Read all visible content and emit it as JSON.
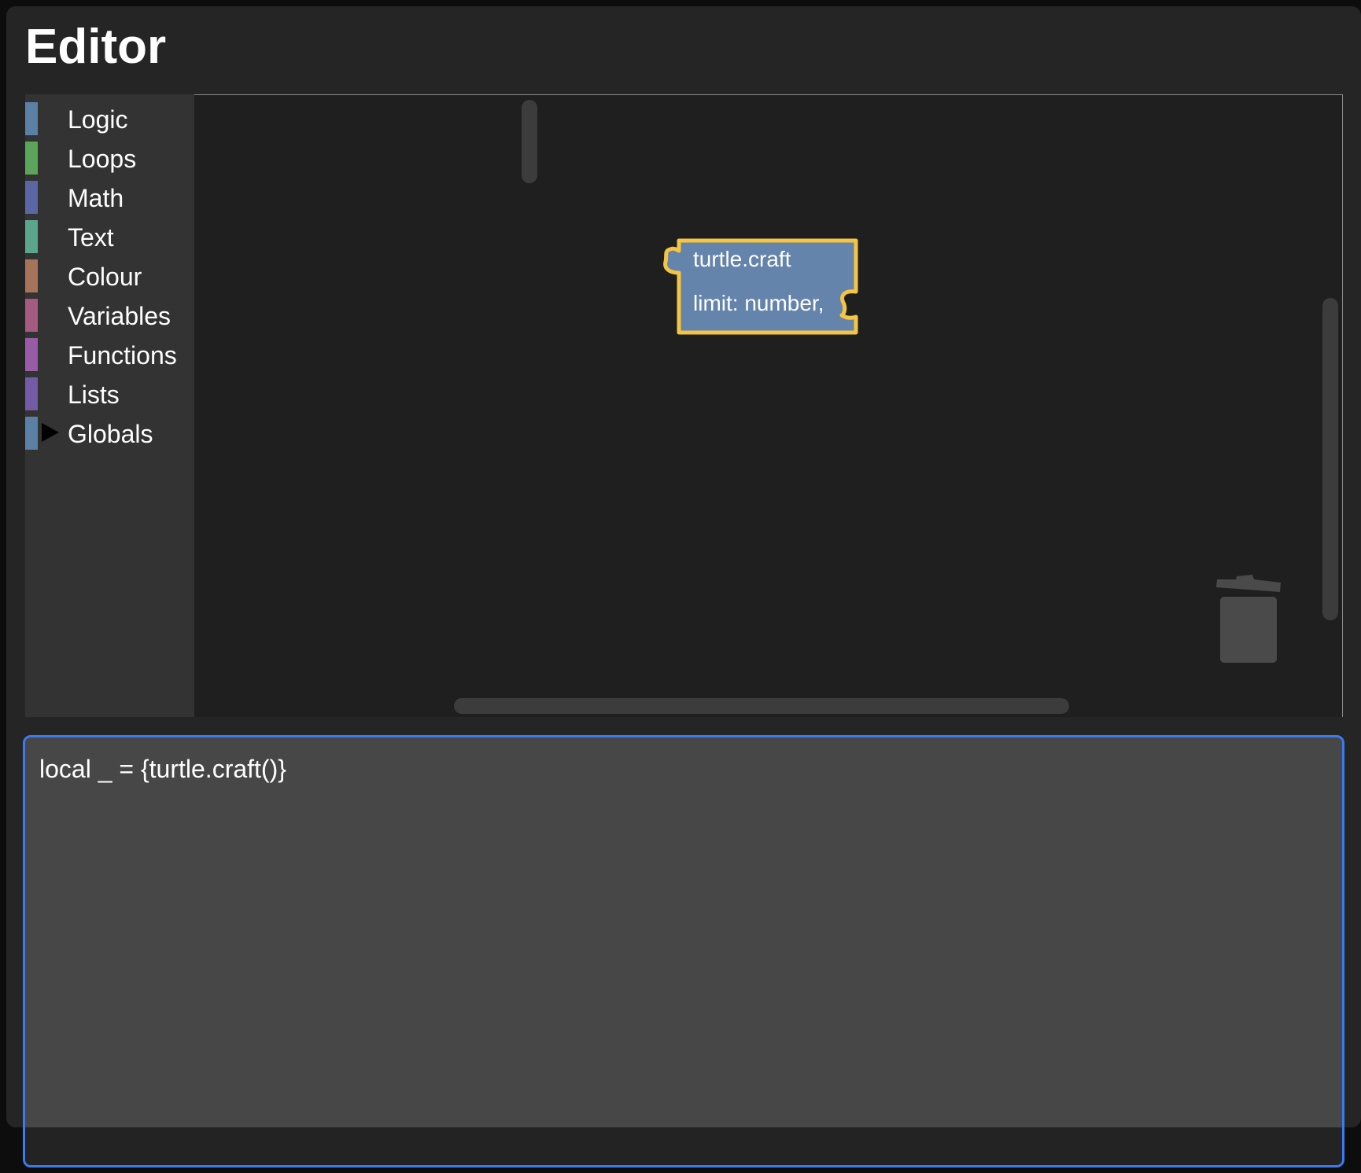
{
  "editor": {
    "title": "Editor"
  },
  "toolbox": {
    "categories": [
      {
        "label": "Logic",
        "color": "#5b80a5",
        "icon": "none"
      },
      {
        "label": "Loops",
        "color": "#5ba55b",
        "icon": "none"
      },
      {
        "label": "Math",
        "color": "#5b67a5",
        "icon": "none"
      },
      {
        "label": "Text",
        "color": "#5ba58c",
        "icon": "none"
      },
      {
        "label": "Colour",
        "color": "#a5745b",
        "icon": "none"
      },
      {
        "label": "Variables",
        "color": "#a55b80",
        "icon": "none"
      },
      {
        "label": "Functions",
        "color": "#995ba5",
        "icon": "none"
      },
      {
        "label": "Lists",
        "color": "#745ba5",
        "icon": "none"
      },
      {
        "label": "Globals",
        "color": "#5b80a5",
        "icon": "expand-arrow-icon"
      }
    ]
  },
  "workspace": {
    "block": {
      "line1": "turtle.craft",
      "line2": "limit: number,",
      "fill_color": "#6584ac",
      "outline_color": "#f5c542"
    },
    "trash_icon": "trash-can-icon"
  },
  "code_output": {
    "text": "local _ = {turtle.craft()}",
    "focus_color": "#3a7bf0"
  }
}
